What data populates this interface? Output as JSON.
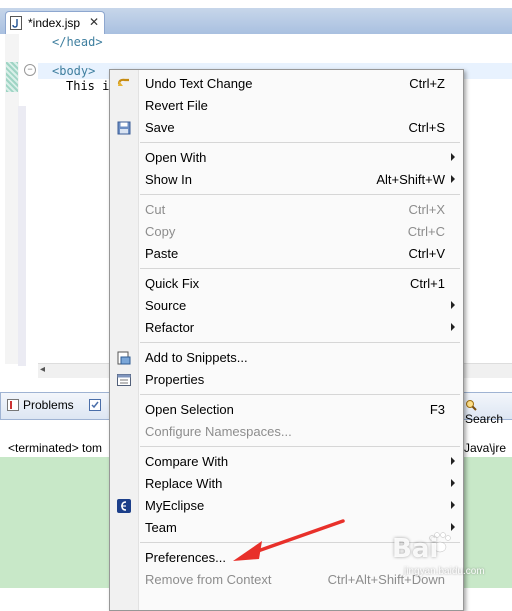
{
  "editor": {
    "tab_title": "*index.jsp",
    "tab_close": "✕",
    "lines": [
      "</head>",
      "<body>",
      "This i"
    ]
  },
  "panel": {
    "tabs": [
      {
        "label": "Problems",
        "icon": "problems-icon"
      },
      {
        "label": "Search",
        "icon": "search-icon"
      }
    ],
    "console_left": "<terminated> tom",
    "console_right": "Java\\jre"
  },
  "context_menu": {
    "groups": [
      [
        {
          "label": "Undo Text Change",
          "shortcut": "Ctrl+Z",
          "icon": "undo-icon",
          "enabled": true
        },
        {
          "label": "Revert File",
          "shortcut": "",
          "enabled": true
        },
        {
          "label": "Save",
          "shortcut": "Ctrl+S",
          "icon": "save-icon",
          "enabled": true
        }
      ],
      [
        {
          "label": "Open With",
          "shortcut": "",
          "submenu": true,
          "enabled": true
        },
        {
          "label": "Show In",
          "shortcut": "Alt+Shift+W",
          "submenu": true,
          "enabled": true
        }
      ],
      [
        {
          "label": "Cut",
          "shortcut": "Ctrl+X",
          "enabled": false
        },
        {
          "label": "Copy",
          "shortcut": "Ctrl+C",
          "enabled": false
        },
        {
          "label": "Paste",
          "shortcut": "Ctrl+V",
          "enabled": true
        }
      ],
      [
        {
          "label": "Quick Fix",
          "shortcut": "Ctrl+1",
          "enabled": true
        },
        {
          "label": "Source",
          "shortcut": "",
          "submenu": true,
          "enabled": true
        },
        {
          "label": "Refactor",
          "shortcut": "",
          "submenu": true,
          "enabled": true
        }
      ],
      [
        {
          "label": "Add to Snippets...",
          "shortcut": "",
          "icon": "snippets-icon",
          "enabled": true
        },
        {
          "label": "Properties",
          "shortcut": "",
          "icon": "properties-icon",
          "enabled": true
        }
      ],
      [
        {
          "label": "Open Selection",
          "shortcut": "F3",
          "enabled": true
        },
        {
          "label": "Configure Namespaces...",
          "shortcut": "",
          "enabled": false
        }
      ],
      [
        {
          "label": "Compare With",
          "shortcut": "",
          "submenu": true,
          "enabled": true
        },
        {
          "label": "Replace With",
          "shortcut": "",
          "submenu": true,
          "enabled": true
        },
        {
          "label": "MyEclipse",
          "shortcut": "",
          "submenu": true,
          "icon": "myeclipse-icon",
          "enabled": true
        },
        {
          "label": "Team",
          "shortcut": "",
          "submenu": true,
          "enabled": true
        }
      ],
      [
        {
          "label": "Preferences...",
          "shortcut": "",
          "enabled": true
        },
        {
          "label": "Remove from Context",
          "shortcut": "Ctrl+Alt+Shift+Down",
          "enabled": false
        }
      ]
    ]
  },
  "watermark": {
    "brand": "Bai",
    "sub": "jingyan.baidu.com"
  },
  "colors": {
    "arrow": "#e8302a",
    "console_bg": "#c8e8c8",
    "tag": "#3f7f9f"
  }
}
